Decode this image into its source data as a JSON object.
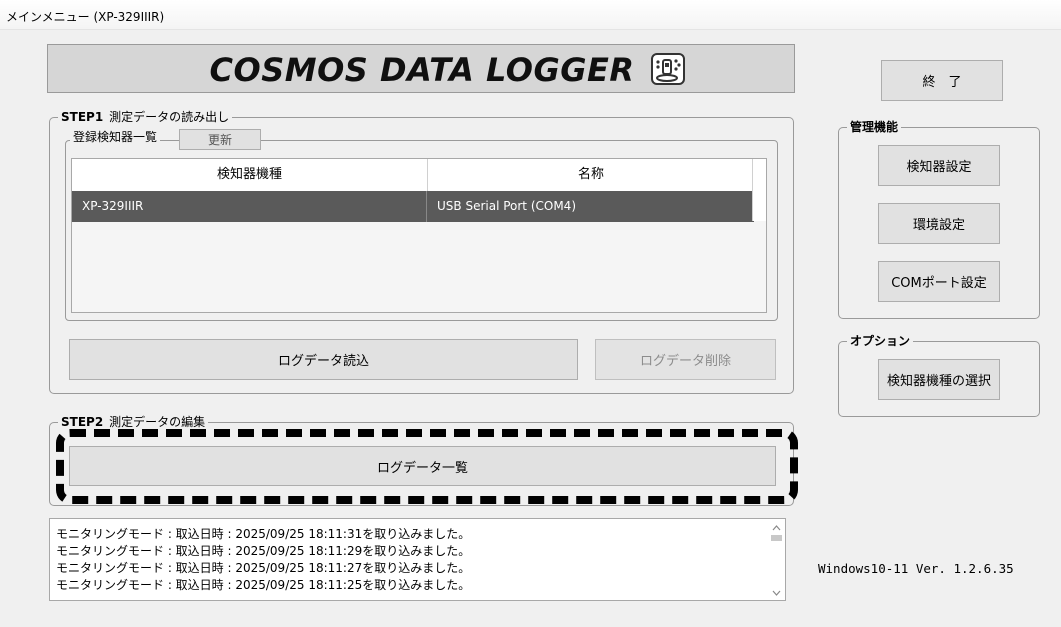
{
  "window": {
    "title": "メインメニュー (XP-329IIIR)"
  },
  "banner": {
    "title": "COSMOS DATA LOGGER",
    "icon": "data-logger-icon"
  },
  "buttons": {
    "exit": "終　了"
  },
  "step1": {
    "title_bold": "STEP1",
    "title": "測定データの読み出し",
    "registered": {
      "title": "登録検知器一覧",
      "refresh": "更新",
      "columns": [
        "検知器機種",
        "名称"
      ],
      "rows": [
        {
          "model": "XP-329IIIR",
          "name": "USB Serial Port (COM4)",
          "selected": true
        }
      ]
    },
    "read_button": "ログデータ読込",
    "delete_button": "ログデータ削除"
  },
  "step2": {
    "title_bold": "STEP2",
    "title": "測定データの編集",
    "list_button": "ログデータ一覧"
  },
  "management": {
    "title": "管理機能",
    "detector_settings": "検知器設定",
    "environment_settings": "環境設定",
    "com_settings": "COMポート設定"
  },
  "options": {
    "title": "オプション",
    "select_model": "検知器機種の選択"
  },
  "log": {
    "lines": [
      "モニタリングモード : 取込日時 : 2025/09/25 18:11:31を取り込みました。",
      "モニタリングモード : 取込日時 : 2025/09/25 18:11:29を取り込みました。",
      "モニタリングモード : 取込日時 : 2025/09/25 18:11:27を取り込みました。",
      "モニタリングモード : 取込日時 : 2025/09/25 18:11:25を取り込みました。"
    ]
  },
  "version": "Windows10-11 Ver. 1.2.6.35",
  "colors": {
    "selected_row": "#5a5a5a",
    "button": "#e1e1e1",
    "banner": "#d6d6d6"
  }
}
